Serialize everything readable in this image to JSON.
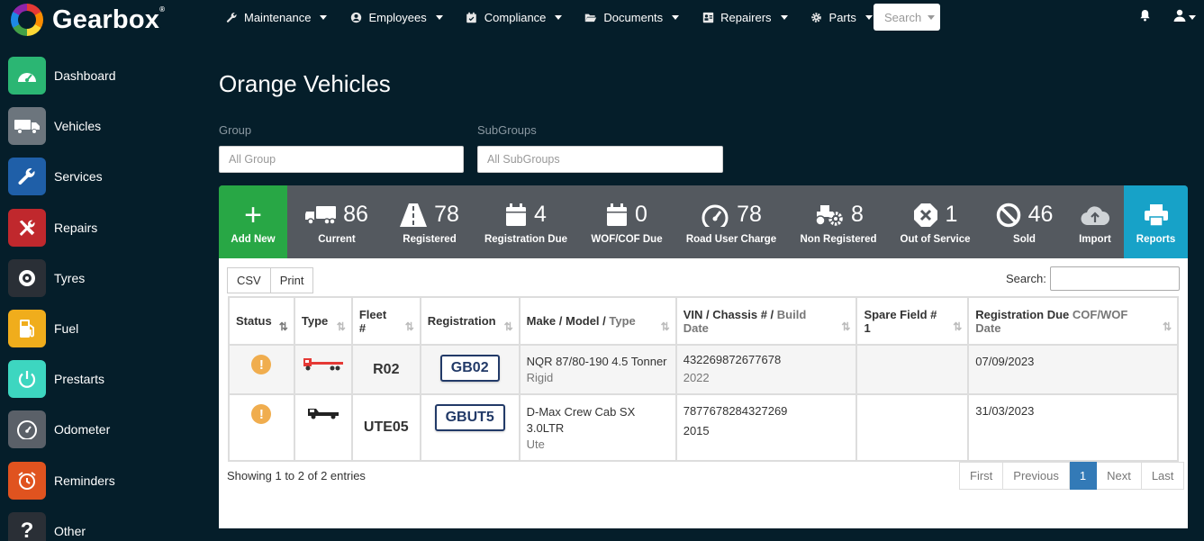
{
  "app": {
    "name": "Gearbox"
  },
  "topnav": {
    "items": [
      {
        "label": "Maintenance",
        "icon": "wrench-icon"
      },
      {
        "label": "Employees",
        "icon": "user-circle-icon"
      },
      {
        "label": "Compliance",
        "icon": "calendar-check-icon"
      },
      {
        "label": "Documents",
        "icon": "folder-open-icon"
      },
      {
        "label": "Repairers",
        "icon": "id-card-icon"
      },
      {
        "label": "Parts",
        "icon": "gear-icon"
      }
    ],
    "search_label": "Search"
  },
  "sidebar": {
    "items": [
      {
        "label": "Dashboard",
        "color": "#2bb673",
        "icon": "gauge-icon"
      },
      {
        "label": "Vehicles",
        "color": "#6c757d",
        "icon": "truck-icon"
      },
      {
        "label": "Services",
        "color": "#1f5fa8",
        "icon": "wrench-icon"
      },
      {
        "label": "Repairs",
        "color": "#c0282d",
        "icon": "tools-icon"
      },
      {
        "label": "Tyres",
        "color": "#2a2f36",
        "icon": "tyre-icon"
      },
      {
        "label": "Fuel",
        "color": "#f0ad1c",
        "icon": "fuel-pump-icon"
      },
      {
        "label": "Prestarts",
        "color": "#3dd6c0",
        "icon": "power-icon"
      },
      {
        "label": "Odometer",
        "color": "#5a6068",
        "icon": "speedometer-icon"
      },
      {
        "label": "Reminders",
        "color": "#e0531f",
        "icon": "alarm-clock-icon"
      },
      {
        "label": "Other",
        "color": "#2a2f36",
        "icon": "question-icon"
      }
    ]
  },
  "page": {
    "title": "Orange Vehicles",
    "group_label": "Group",
    "group_placeholder": "All Group",
    "subgroup_label": "SubGroups",
    "subgroup_placeholder": "All SubGroups"
  },
  "stats": {
    "add_new": "Add New",
    "items": [
      {
        "value": "86",
        "label": "Current",
        "icon": "truck-icon"
      },
      {
        "value": "78",
        "label": "Registered",
        "icon": "road-icon"
      },
      {
        "value": "4",
        "label": "Registration Due",
        "icon": "calendar-icon"
      },
      {
        "value": "0",
        "label": "WOF/COF Due",
        "icon": "calendar-icon"
      },
      {
        "value": "78",
        "label": "Road User Charge",
        "icon": "gauge-icon"
      },
      {
        "value": "8",
        "label": "Non Registered",
        "icon": "tractor-icon"
      },
      {
        "value": "1",
        "label": "Out of Service",
        "icon": "stop-x-icon"
      },
      {
        "value": "46",
        "label": "Sold",
        "icon": "ban-icon"
      }
    ],
    "import": "Import",
    "reports": "Reports"
  },
  "table": {
    "csv": "CSV",
    "print": "Print",
    "search_label": "Search:",
    "headers": {
      "status": "Status",
      "type": "Type",
      "fleet": "Fleet #",
      "registration": "Registration",
      "make_model": "Make / Model /",
      "make_type": "Type",
      "vin": "VIN / Chassis # /",
      "vin_build": "Build Date",
      "spare": "Spare Field # 1",
      "reg_due": "Registration Due",
      "reg_due_sub": "COF/WOF Date"
    },
    "rows": [
      {
        "fleet": "R02",
        "registration": "GB02",
        "make": "NQR 87/80-190 4.5 Tonner",
        "type": "Rigid",
        "vin": "432269872677678",
        "build": "2022",
        "spare": "",
        "due": "07/09/2023"
      },
      {
        "fleet": "UTE05",
        "registration": "GBUT5",
        "make": "D-Max Crew Cab SX 3.0LTR",
        "type": "Ute",
        "vin": "7877678284327269",
        "build": "2015",
        "spare": "",
        "due": "31/03/2023"
      }
    ],
    "showing": "Showing 1 to 2 of 2 entries",
    "pager": {
      "first": "First",
      "previous": "Previous",
      "page": "1",
      "next": "Next",
      "last": "Last"
    }
  }
}
